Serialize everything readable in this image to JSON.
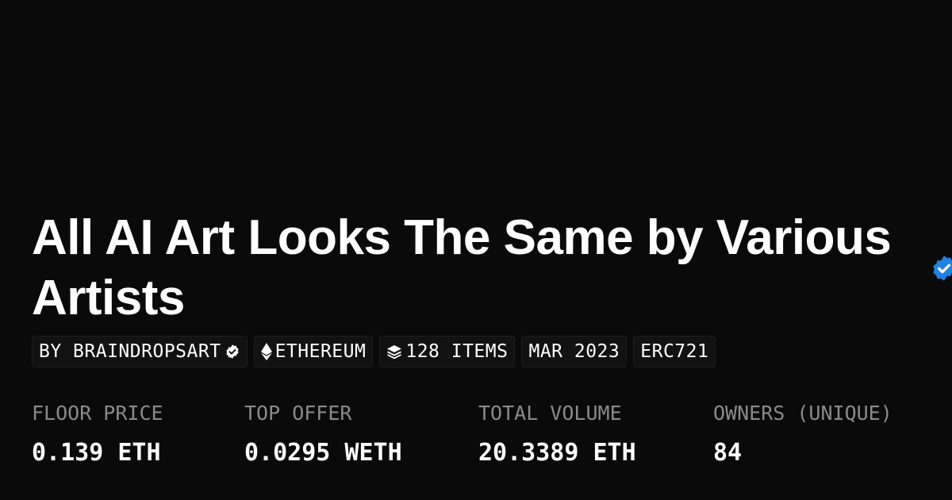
{
  "collection": {
    "title": "All AI Art Looks The Same by Various Artists",
    "verified_icon": "verified-badge-icon",
    "accent_color": "#2081e2"
  },
  "pills": {
    "creator": "BY BRAINDROPSART",
    "chain": "ETHEREUM",
    "items": "128 ITEMS",
    "date": "MAR 2023",
    "standard": "ERC721"
  },
  "stats": [
    {
      "label": "FLOOR PRICE",
      "value": "0.139 ETH"
    },
    {
      "label": "TOP OFFER",
      "value": "0.0295 WETH"
    },
    {
      "label": "TOTAL VOLUME",
      "value": "20.3389 ETH"
    },
    {
      "label": "OWNERS (UNIQUE)",
      "value": "84"
    }
  ]
}
